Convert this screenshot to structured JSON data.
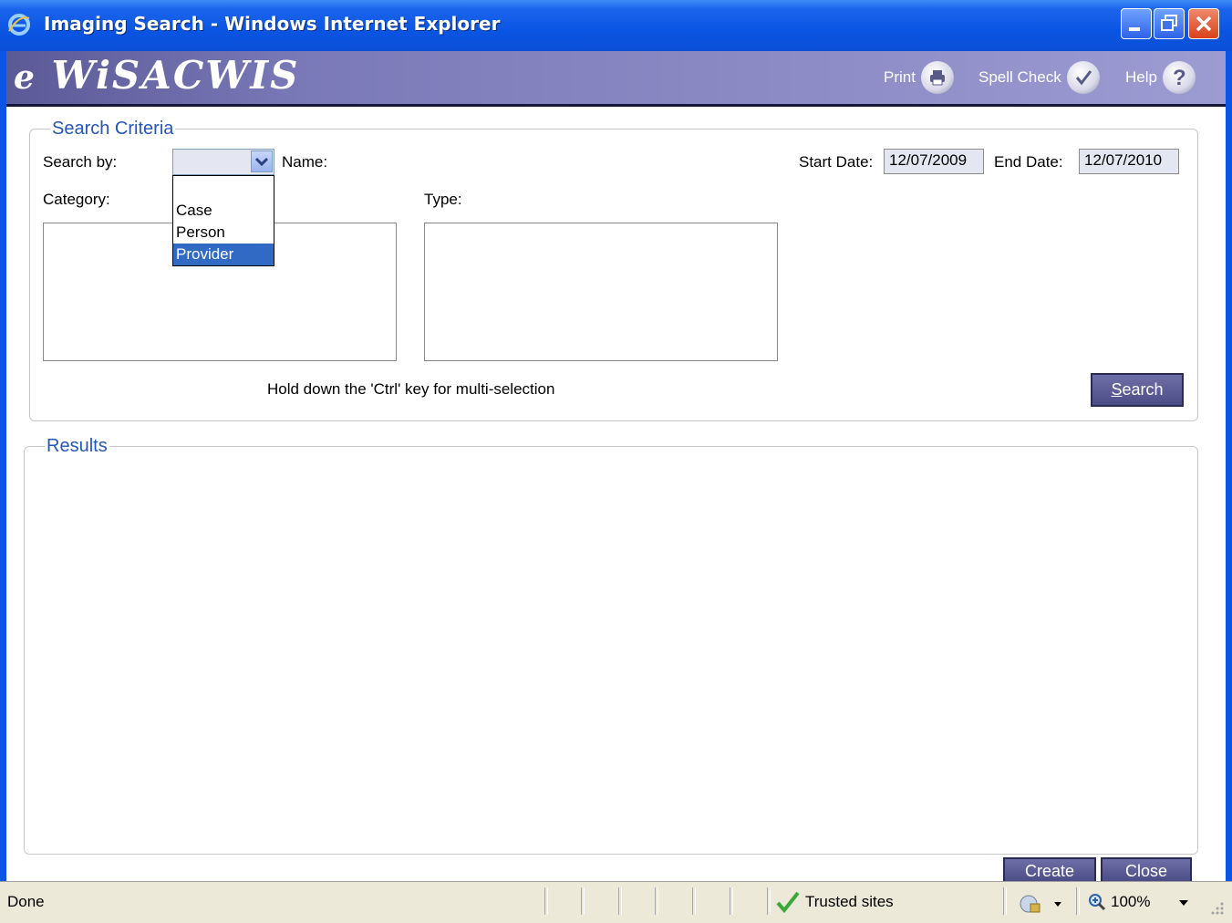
{
  "window": {
    "title": "Imaging Search - Windows Internet Explorer"
  },
  "app": {
    "brand_e": "e",
    "brand_name": "WiSACWIS",
    "toolbar": {
      "print": "Print",
      "spellcheck": "Spell Check",
      "help": "Help"
    }
  },
  "search_criteria": {
    "legend": "Search Criteria",
    "search_by_label": "Search by:",
    "search_by_value": "",
    "search_by_options": [
      "Case",
      "Person",
      "Provider"
    ],
    "search_by_highlighted": "Provider",
    "name_label": "Name:",
    "start_date_label": "Start Date:",
    "start_date": "12/07/2009",
    "end_date_label": "End Date:",
    "end_date": "12/07/2010",
    "category_label": "Category:",
    "type_label": "Type:",
    "hint": "Hold down the 'Ctrl' key for multi-selection",
    "search_button_accesskey": "S",
    "search_button_rest": "earch"
  },
  "results": {
    "legend": "Results"
  },
  "footer_buttons": {
    "create": "Create",
    "close": "Close"
  },
  "statusbar": {
    "status": "Done",
    "zone": "Trusted sites",
    "zoom": "100%"
  },
  "colors": {
    "title_blue": "#0a55e3",
    "accent": "#2457b8",
    "appbar": "#7b7ab8",
    "selection": "#316ac5"
  }
}
